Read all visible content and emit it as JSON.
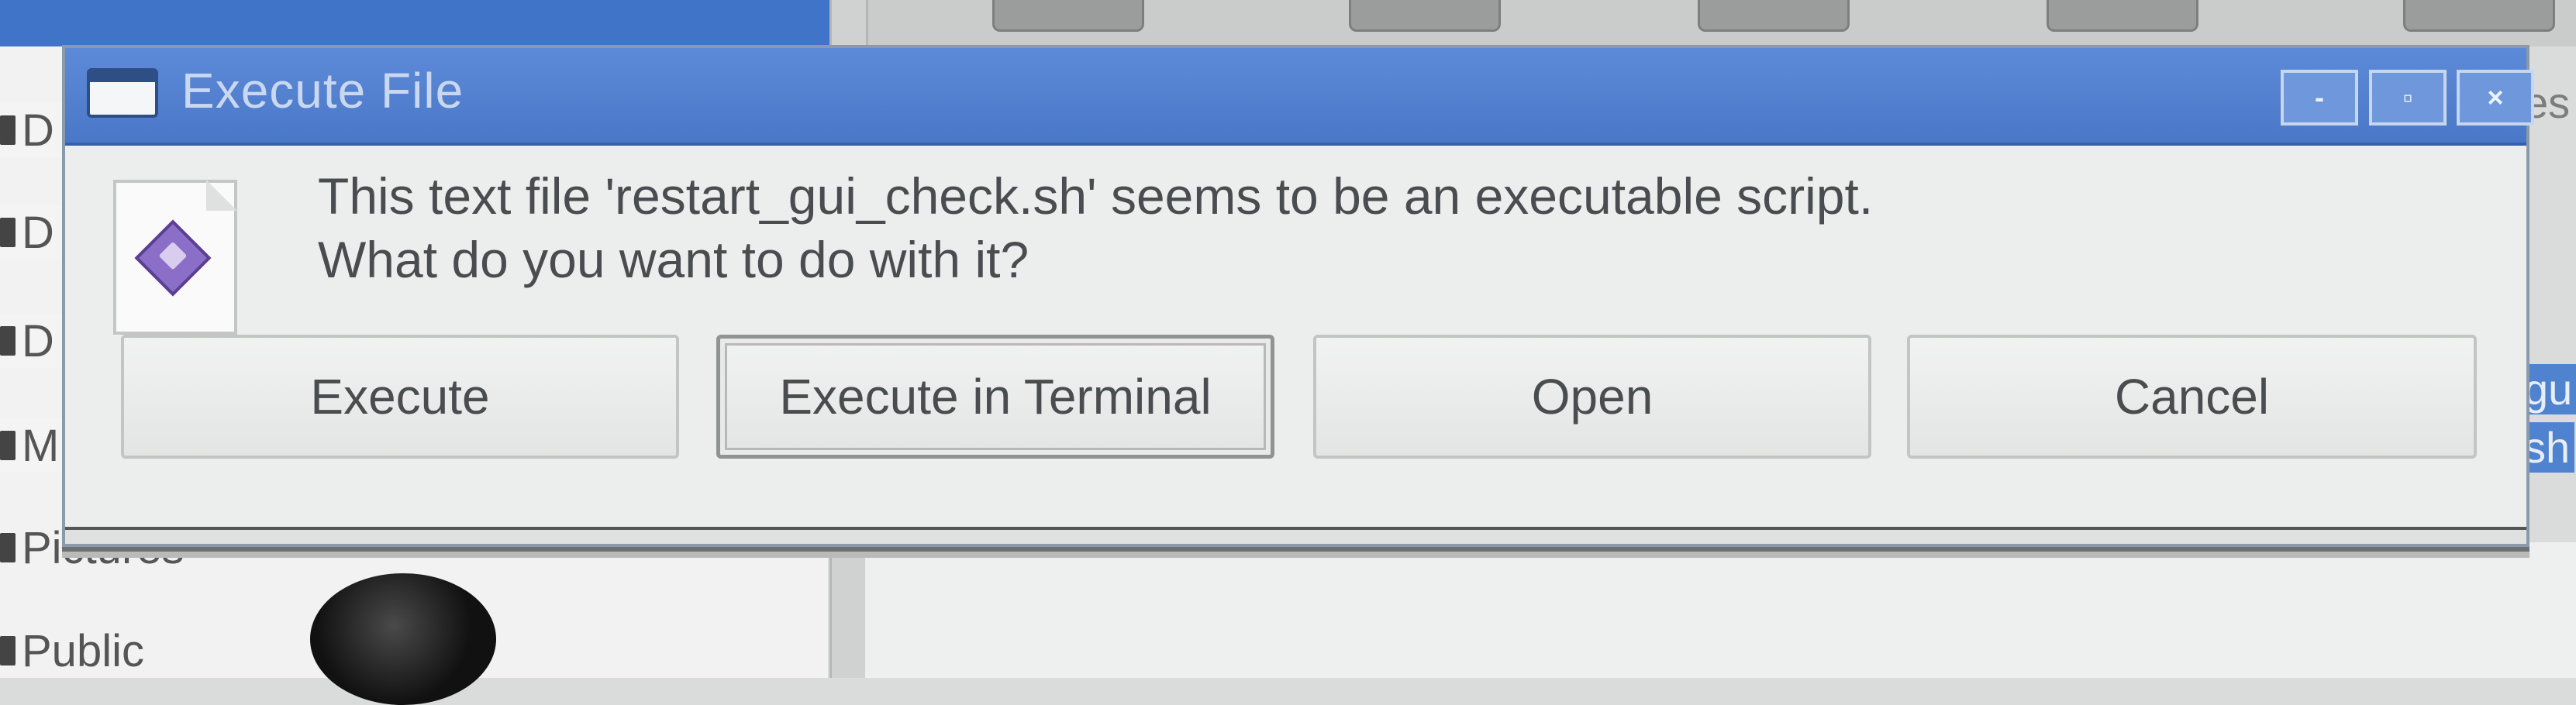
{
  "background": {
    "sidebar_items": [
      "D",
      "D",
      "D",
      "M",
      "Pictures",
      "Public"
    ],
    "right_fragments": [
      "es",
      "gu",
      "sh"
    ]
  },
  "dialog": {
    "title": "Execute File",
    "window_controls": {
      "minimize": "-",
      "maximize": "▫",
      "close": "×"
    },
    "message_line1": "This text file 'restart_gui_check.sh' seems to be an executable script.",
    "message_line2": "What do you want to do with it?",
    "buttons": {
      "execute": "Execute",
      "execute_in_terminal": "Execute in Terminal",
      "open": "Open",
      "cancel": "Cancel"
    },
    "focused_button": "execute_in_terminal",
    "icon": "shell-script-file-icon"
  },
  "colors": {
    "titlebar": "#4a78c8",
    "dialog_bg": "#eceeed",
    "text": "#4a4d50"
  }
}
